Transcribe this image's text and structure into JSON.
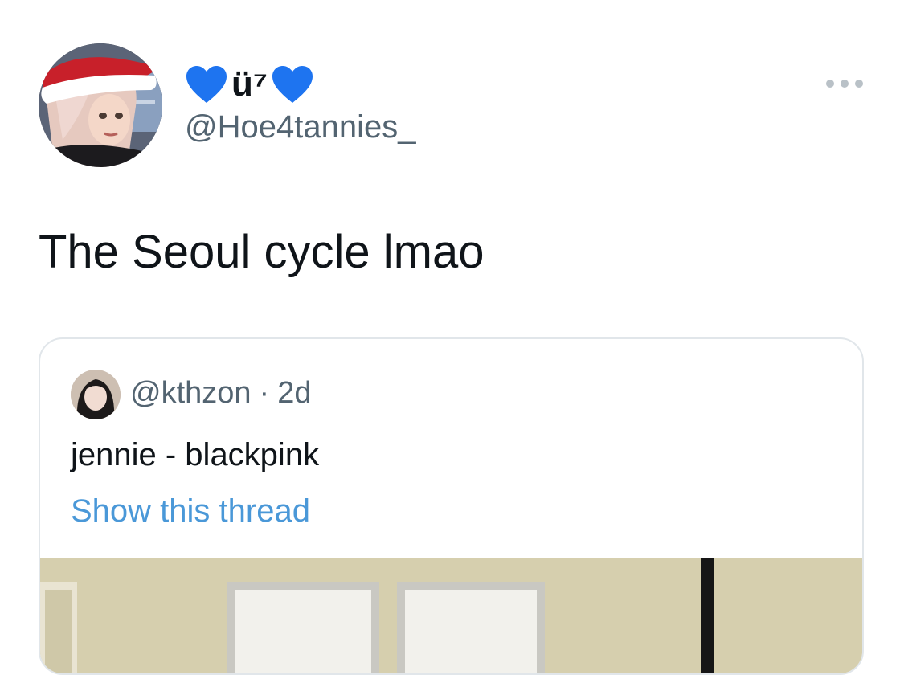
{
  "author": {
    "display_name": "ü⁷",
    "handle": "@Hoe4tannies_",
    "heart_color": "#1e74f0",
    "avatar": "santa-hat-animated-character-avatar"
  },
  "menu_icon": "more-horizontal-icon",
  "tweet": {
    "text": "The Seoul cycle lmao"
  },
  "quoted_tweet": {
    "handle": "@kthzon",
    "separator": "·",
    "time": "2d",
    "text": "jennie - blackpink",
    "show_thread_label": "Show this thread",
    "link_color": "#4a98d8"
  }
}
